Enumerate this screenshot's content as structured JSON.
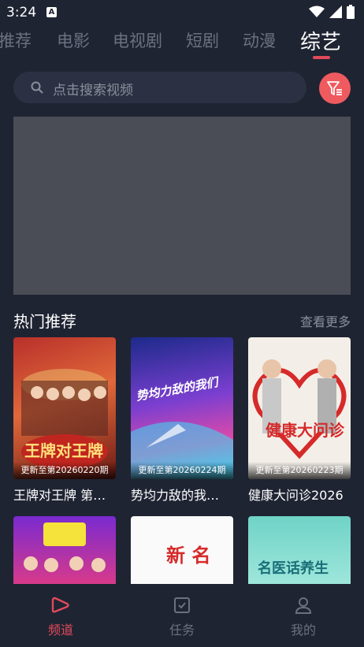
{
  "status": {
    "time": "3:24",
    "notification_icon": "A"
  },
  "tabs": [
    {
      "label": "推荐"
    },
    {
      "label": "电影"
    },
    {
      "label": "电视剧"
    },
    {
      "label": "短剧"
    },
    {
      "label": "动漫"
    },
    {
      "label": "综艺"
    }
  ],
  "search": {
    "placeholder": "点击搜索视频"
  },
  "section": {
    "title": "热门推荐",
    "more": "查看更多"
  },
  "cards": [
    {
      "title": "王牌对王牌 第…",
      "update": "更新至第20260220期",
      "poster_text": "王牌对王牌"
    },
    {
      "title": "势均力敌的我…",
      "update": "更新至第20260224期",
      "poster_text": "势均力敌的我们"
    },
    {
      "title": "健康大问诊2026",
      "update": "更新至第20260223期",
      "poster_text": "健康大问诊"
    },
    {
      "title": "",
      "update": "",
      "poster_text": ""
    },
    {
      "title": "",
      "update": "",
      "poster_text": "新 名"
    },
    {
      "title": "",
      "update": "",
      "poster_text": "名医话养生"
    }
  ],
  "nav": [
    {
      "label": "频道"
    },
    {
      "label": "任务"
    },
    {
      "label": "我的"
    }
  ],
  "colors": {
    "accent": "#e24a5a",
    "background": "#1f2433",
    "filter": "#ef5a5f"
  }
}
